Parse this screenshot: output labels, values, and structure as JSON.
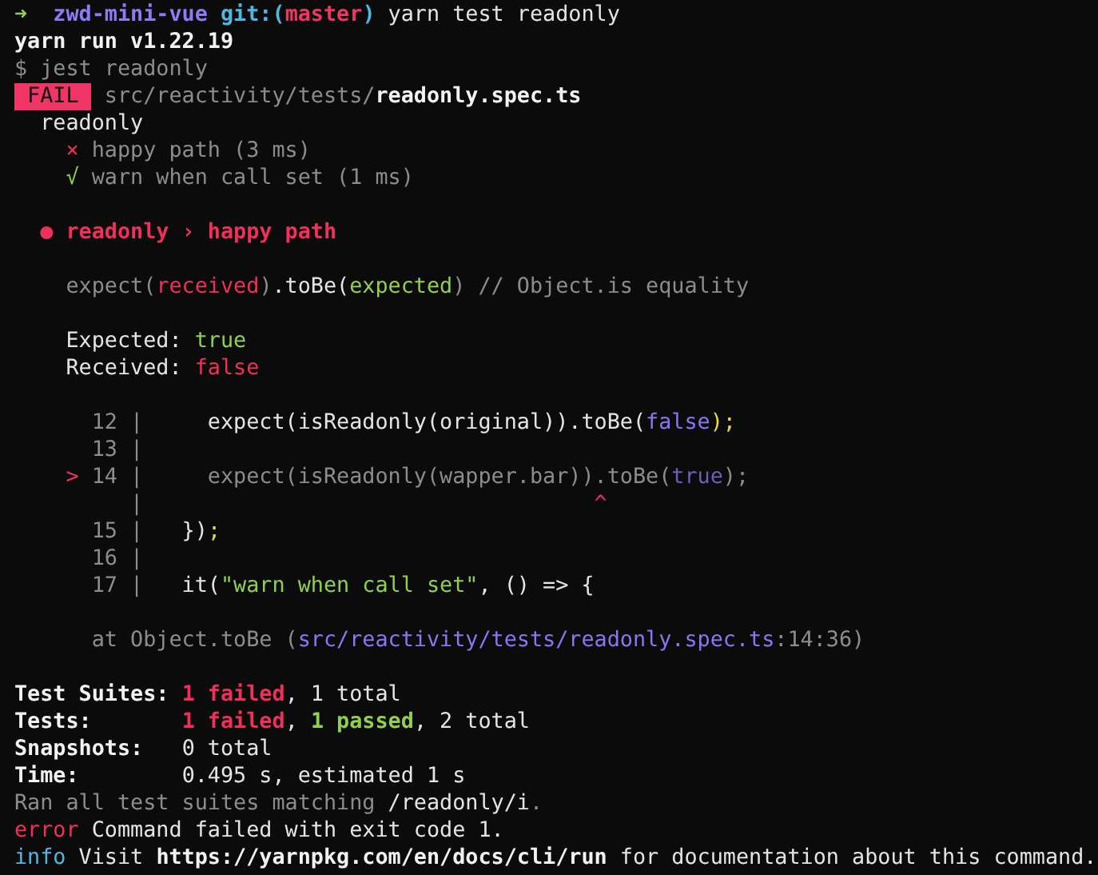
{
  "terminal": {
    "lines": [
      {
        "kind": "text",
        "segments": [
          {
            "kind": "arrow",
            "text": "➜ "
          },
          {
            "kind": "dir",
            "text": " zwd-mini-vue "
          },
          {
            "kind": "git",
            "text": "git:("
          },
          {
            "kind": "branch",
            "text": "master"
          },
          {
            "kind": "git",
            "text": ")"
          },
          {
            "kind": "plain",
            "text": " yarn test readonly"
          }
        ]
      },
      {
        "kind": "text",
        "segments": [
          {
            "kind": "bold",
            "text": "yarn run v1.22.19"
          }
        ]
      },
      {
        "kind": "text",
        "segments": [
          {
            "kind": "dim",
            "text": "$ jest readonly"
          }
        ]
      },
      {
        "kind": "text",
        "segments": [
          {
            "kind": "badge",
            "text": " FAIL "
          },
          {
            "kind": "dim",
            "text": " src/reactivity/tests/"
          },
          {
            "kind": "bold",
            "text": "readonly.spec.ts"
          }
        ]
      },
      {
        "kind": "text",
        "segments": [
          {
            "kind": "plain",
            "text": "  readonly"
          }
        ]
      },
      {
        "kind": "text",
        "segments": [
          {
            "kind": "red",
            "text": "    ×"
          },
          {
            "kind": "dim",
            "text": " happy path (3 ms)"
          }
        ]
      },
      {
        "kind": "text",
        "segments": [
          {
            "kind": "green",
            "text": "    √"
          },
          {
            "kind": "dim",
            "text": " warn when call set (1 ms)"
          }
        ]
      },
      {
        "kind": "blank"
      },
      {
        "kind": "text",
        "segments": [
          {
            "kind": "redbold",
            "text": "  ● readonly › happy path"
          }
        ]
      },
      {
        "kind": "blank"
      },
      {
        "kind": "text",
        "segments": [
          {
            "kind": "dim",
            "text": "    expect("
          },
          {
            "kind": "red",
            "text": "received"
          },
          {
            "kind": "dim",
            "text": ")"
          },
          {
            "kind": "plain",
            "text": ".toBe("
          },
          {
            "kind": "green",
            "text": "expected"
          },
          {
            "kind": "dim",
            "text": ") // Object.is equality"
          }
        ]
      },
      {
        "kind": "blank"
      },
      {
        "kind": "text",
        "segments": [
          {
            "kind": "plain",
            "text": "    Expected: "
          },
          {
            "kind": "green",
            "text": "true"
          }
        ]
      },
      {
        "kind": "text",
        "segments": [
          {
            "kind": "plain",
            "text": "    Received: "
          },
          {
            "kind": "red",
            "text": "false"
          }
        ]
      },
      {
        "kind": "blank"
      },
      {
        "kind": "text",
        "segments": [
          {
            "kind": "dim",
            "text": "      12 |"
          },
          {
            "kind": "plain",
            "text": "     expect(isReadonly(original)).toBe("
          },
          {
            "kind": "purple",
            "text": "false"
          },
          {
            "kind": "yellow",
            "text": ");"
          }
        ]
      },
      {
        "kind": "text",
        "segments": [
          {
            "kind": "dim",
            "text": "      13 |"
          }
        ]
      },
      {
        "kind": "text",
        "segments": [
          {
            "kind": "red",
            "text": "    >"
          },
          {
            "kind": "dim",
            "text": " 14 |     expect(isReadonly(wapper.bar)).toBe("
          },
          {
            "kind": "dimpurple",
            "text": "true"
          },
          {
            "kind": "dim",
            "text": ");"
          }
        ]
      },
      {
        "kind": "text",
        "segments": [
          {
            "kind": "dim",
            "text": "         |"
          },
          {
            "kind": "red",
            "text": "                                   ^"
          }
        ]
      },
      {
        "kind": "text",
        "segments": [
          {
            "kind": "dim",
            "text": "      15 |"
          },
          {
            "kind": "plain",
            "text": "   })"
          },
          {
            "kind": "yellow",
            "text": ";"
          }
        ]
      },
      {
        "kind": "text",
        "segments": [
          {
            "kind": "dim",
            "text": "      16 |"
          }
        ]
      },
      {
        "kind": "text",
        "segments": [
          {
            "kind": "dim",
            "text": "      17 |"
          },
          {
            "kind": "plain",
            "text": "   it("
          },
          {
            "kind": "green",
            "text": "\"warn when call set\""
          },
          {
            "kind": "plain",
            "text": ", () => {"
          }
        ]
      },
      {
        "kind": "blank"
      },
      {
        "kind": "text",
        "segments": [
          {
            "kind": "dim",
            "text": "      at Object.toBe ("
          },
          {
            "kind": "purple",
            "text": "src/reactivity/tests/readonly.spec.ts"
          },
          {
            "kind": "dim",
            "text": ":14:36)"
          }
        ]
      },
      {
        "kind": "blank"
      },
      {
        "kind": "text",
        "segments": [
          {
            "kind": "bold",
            "text": "Test Suites: "
          },
          {
            "kind": "redbold",
            "text": "1 failed"
          },
          {
            "kind": "plain",
            "text": ", 1 total"
          }
        ]
      },
      {
        "kind": "text",
        "segments": [
          {
            "kind": "bold",
            "text": "Tests:       "
          },
          {
            "kind": "redbold",
            "text": "1 failed"
          },
          {
            "kind": "plain",
            "text": ", "
          },
          {
            "kind": "greenbold",
            "text": "1 passed"
          },
          {
            "kind": "plain",
            "text": ", 2 total"
          }
        ]
      },
      {
        "kind": "text",
        "segments": [
          {
            "kind": "bold",
            "text": "Snapshots:   "
          },
          {
            "kind": "plain",
            "text": "0 total"
          }
        ]
      },
      {
        "kind": "text",
        "segments": [
          {
            "kind": "bold",
            "text": "Time:        "
          },
          {
            "kind": "plain",
            "text": "0.495 s, estimated 1 s"
          }
        ]
      },
      {
        "kind": "text",
        "segments": [
          {
            "kind": "dim",
            "text": "Ran all test suites matching "
          },
          {
            "kind": "plain",
            "text": "/readonly/i"
          },
          {
            "kind": "dim",
            "text": "."
          }
        ]
      },
      {
        "kind": "text",
        "segments": [
          {
            "kind": "red",
            "text": "error"
          },
          {
            "kind": "plain",
            "text": " Command failed with exit code 1."
          }
        ]
      },
      {
        "kind": "text",
        "segments": [
          {
            "kind": "blue",
            "text": "info"
          },
          {
            "kind": "plain",
            "text": " Visit "
          },
          {
            "kind": "bold",
            "text": "https://yarnpkg.com/en/docs/cli/run"
          },
          {
            "kind": "plain",
            "text": " for documentation about this command."
          }
        ]
      }
    ]
  }
}
